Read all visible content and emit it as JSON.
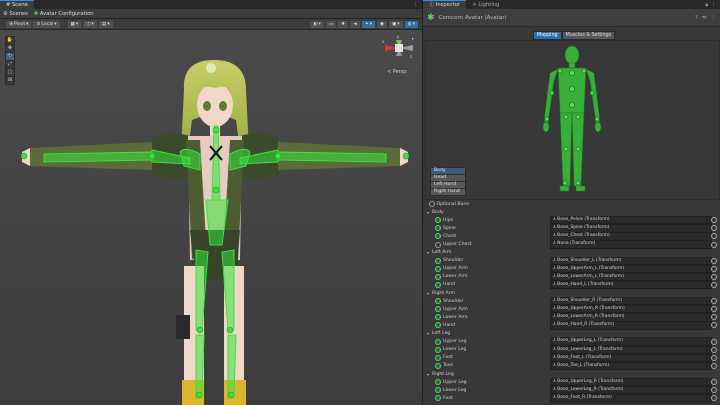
{
  "scene": {
    "tabs": [
      "Scene"
    ],
    "breadcrumb": {
      "scenes": "Scenes",
      "current": "Avatar Configuration"
    },
    "toolbar": {
      "pivot": "Pivot",
      "local": "Local"
    },
    "persp_label": "< Persp",
    "gizmo_axes": {
      "x": "x",
      "y": "y",
      "z": "z"
    }
  },
  "inspector": {
    "tabs": [
      {
        "label": "Inspector"
      },
      {
        "label": "Lighting"
      }
    ],
    "title": "Comcorn Avatar (Avatar)",
    "mode_buttons": [
      "Mapping",
      "Muscles & Settings"
    ],
    "body_parts": [
      "Body",
      "Head",
      "Left Hand",
      "Right Hand"
    ],
    "optional_bone": "Optional Bone",
    "groups": [
      {
        "name": "Body",
        "bones": [
          {
            "name": "Hips",
            "value": "⅄ Bone_Pelvis (Transform)",
            "mapped": true
          },
          {
            "name": "Spine",
            "value": "⅄ Bone_Spine (Transform)",
            "mapped": true
          },
          {
            "name": "Chest",
            "value": "⅄ Bone_Chest (Transform)",
            "mapped": true
          },
          {
            "name": "Upper Chest",
            "value": "⅄ None (Transform)",
            "mapped": false
          }
        ]
      },
      {
        "name": "Left Arm",
        "bones": [
          {
            "name": "Shoulder",
            "value": "⅄ Bone_Shoulder_L (Transform)",
            "mapped": true
          },
          {
            "name": "Upper Arm",
            "value": "⅄ Bone_UpperArm_L (Transform)",
            "mapped": true
          },
          {
            "name": "Lower Arm",
            "value": "⅄ Bone_LowerArm_L (Transform)",
            "mapped": true
          },
          {
            "name": "Hand",
            "value": "⅄ Bone_Hand_L (Transform)",
            "mapped": true
          }
        ]
      },
      {
        "name": "Right Arm",
        "bones": [
          {
            "name": "Shoulder",
            "value": "⅄ Bone_Shoulder_R (Transform)",
            "mapped": true
          },
          {
            "name": "Upper Arm",
            "value": "⅄ Bone_UpperArm_R (Transform)",
            "mapped": true
          },
          {
            "name": "Lower Arm",
            "value": "⅄ Bone_LowerArm_R (Transform)",
            "mapped": true
          },
          {
            "name": "Hand",
            "value": "⅄ Bone_Hand_R (Transform)",
            "mapped": true
          }
        ]
      },
      {
        "name": "Left Leg",
        "bones": [
          {
            "name": "Upper Leg",
            "value": "⅄ Bone_UpperLeg_L (Transform)",
            "mapped": true
          },
          {
            "name": "Lower Leg",
            "value": "⅄ Bone_LowerLeg_L (Transform)",
            "mapped": true
          },
          {
            "name": "Foot",
            "value": "⅄ Bone_Foot_L (Transform)",
            "mapped": true
          },
          {
            "name": "Toes",
            "value": "⅄ Bone_Toe_L (Transform)",
            "mapped": true
          }
        ]
      },
      {
        "name": "Right Leg",
        "bones": [
          {
            "name": "Upper Leg",
            "value": "⅄ Bone_UpperLeg_R (Transform)",
            "mapped": true
          },
          {
            "name": "Lower Leg",
            "value": "⅄ Bone_LowerLeg_R (Transform)",
            "mapped": true
          },
          {
            "name": "Foot",
            "value": "⅄ Bone_Foot_R (Transform)",
            "mapped": true
          }
        ]
      }
    ]
  },
  "colors": {
    "accent": "#2e6fa8",
    "bone_green": "#39e43c",
    "mapped_dot": "#5cd36c"
  }
}
